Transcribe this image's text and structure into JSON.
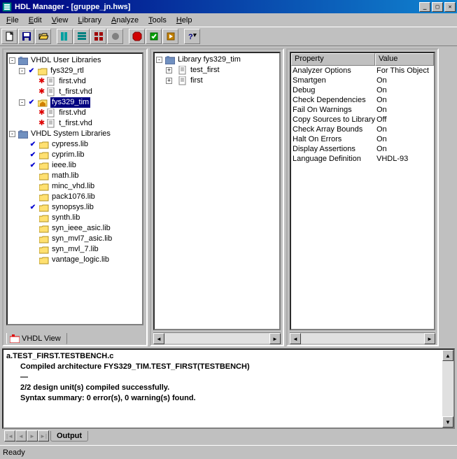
{
  "window": {
    "title": "HDL Manager - [gruppe_jn.hws]"
  },
  "menubar": [
    "File",
    "Edit",
    "View",
    "Library",
    "Analyze",
    "Tools",
    "Help"
  ],
  "user_lib_root": "VHDL User Libraries",
  "sys_lib_root": "VHDL System Libraries",
  "user_libs": [
    {
      "name": "fys329_rtl",
      "checked": true,
      "files": [
        "first.vhd",
        "t_first.vhd"
      ]
    },
    {
      "name": "fys329_tim",
      "checked": true,
      "selected": true,
      "files": [
        "first.vhd",
        "t_first.vhd"
      ]
    }
  ],
  "sys_libs": [
    {
      "name": "cypress.lib",
      "checked": true
    },
    {
      "name": "cyprim.lib",
      "checked": true
    },
    {
      "name": "ieee.lib",
      "checked": true
    },
    {
      "name": "math.lib",
      "checked": false
    },
    {
      "name": "minc_vhd.lib",
      "checked": false
    },
    {
      "name": "pack1076.lib",
      "checked": false
    },
    {
      "name": "synopsys.lib",
      "checked": true
    },
    {
      "name": "synth.lib",
      "checked": false
    },
    {
      "name": "syn_ieee_asic.lib",
      "checked": false
    },
    {
      "name": "syn_mvl7_asic.lib",
      "checked": false
    },
    {
      "name": "syn_mvl_7.lib",
      "checked": false
    },
    {
      "name": "vantage_logic.lib",
      "checked": false
    }
  ],
  "left_tab": "VHDL View",
  "mid_tree": {
    "root": "Library fys329_tim",
    "items": [
      "test_first",
      "first"
    ]
  },
  "prop_headers": {
    "k": "Property",
    "v": "Value"
  },
  "properties": [
    {
      "k": "Analyzer Options",
      "v": "For This Object"
    },
    {
      "k": "Smartgen",
      "v": "On"
    },
    {
      "k": "Debug",
      "v": "On"
    },
    {
      "k": "Check Dependencies",
      "v": "On"
    },
    {
      "k": "Fail On Warnings",
      "v": "On"
    },
    {
      "k": "Copy Sources to Library",
      "v": "Off"
    },
    {
      "k": "Check Array Bounds",
      "v": "On"
    },
    {
      "k": "Halt On Errors",
      "v": "On"
    },
    {
      "k": "Display Assertions",
      "v": "On"
    },
    {
      "k": "Language Definition",
      "v": "VHDL-93"
    }
  ],
  "output": {
    "line1": "a.TEST_FIRST.TESTBENCH.c",
    "line2": "Compiled architecture FYS329_TIM.TEST_FIRST(TESTBENCH)",
    "line3": "—",
    "line4": "2/2 design unit(s) compiled successfully.",
    "line5": "Syntax summary: 0 error(s), 0 warning(s) found.",
    "tab": "Output"
  },
  "status": "Ready"
}
